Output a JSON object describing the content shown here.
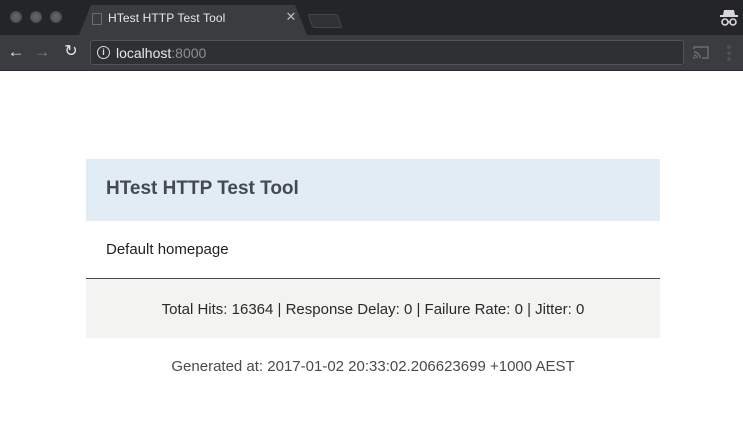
{
  "browser": {
    "tab_title": "HTest HTTP Test Tool",
    "tab_close_icon": "close-icon",
    "url_host": "localhost",
    "url_port": ":8000",
    "theme": {
      "frame": "#242528",
      "toolbar": "#3b3c3f"
    }
  },
  "page": {
    "header_title": "HTest HTTP Test Tool",
    "body_text": "Default homepage",
    "stats": "Total Hits: 16364 | Response Delay: 0 | Failure Rate: 0 | Jitter: 0",
    "generated": "Generated at: 2017-01-02 20:33:02.206623699 +1000 AEST",
    "colors": {
      "header_bg": "#e2ecf4",
      "footer_bg": "#f3f3f2"
    }
  }
}
